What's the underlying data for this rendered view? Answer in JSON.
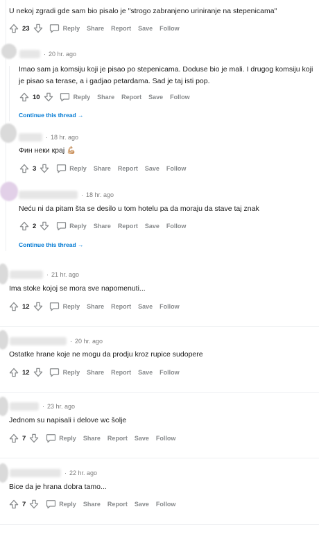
{
  "labels": {
    "reply": "Reply",
    "share": "Share",
    "report": "Report",
    "save": "Save",
    "follow": "Follow",
    "continue_thread": "Continue this thread →"
  },
  "colors": {
    "link": "#0079d3",
    "muted": "#878a8c",
    "text": "#1c1c1c"
  },
  "comments": [
    {
      "id": "c0",
      "time": "",
      "text": "U nekoj zgradi gde sam bio pisalo je \"strogo zabranjeno uriniranje na stepenicama\"",
      "votes": "23"
    },
    {
      "id": "c1",
      "time": "20 hr. ago",
      "text": "Imao sam ja komsiju koji je pisao po stepenicama. Doduse bio je mali. I drugog komsiju koji je pisao sa terase, a i gadjao petardama. Sad je taj isti pop.",
      "votes": "10"
    },
    {
      "id": "c2",
      "time": "18 hr. ago",
      "text": "Фин неки крај 💪🏼",
      "votes": "3"
    },
    {
      "id": "c3",
      "time": "18 hr. ago",
      "text": "Neću ni da pitam šta se desilo u tom hotelu pa da moraju da stave taj znak",
      "votes": "2"
    },
    {
      "id": "c4",
      "time": "21 hr. ago",
      "text": "Ima stoke kojoj se mora sve napomenuti...",
      "votes": "12"
    },
    {
      "id": "c5",
      "time": "20 hr. ago",
      "text": "Ostatke hrane koje ne mogu da prodju kroz rupice sudopere",
      "votes": "12"
    },
    {
      "id": "c6",
      "time": "23 hr. ago",
      "text": "Jednom su napisali i delove wc šolje",
      "votes": "7"
    },
    {
      "id": "c7",
      "time": "22 hr. ago",
      "text": "Bice da je hrana dobra tamo...",
      "votes": "7"
    }
  ]
}
